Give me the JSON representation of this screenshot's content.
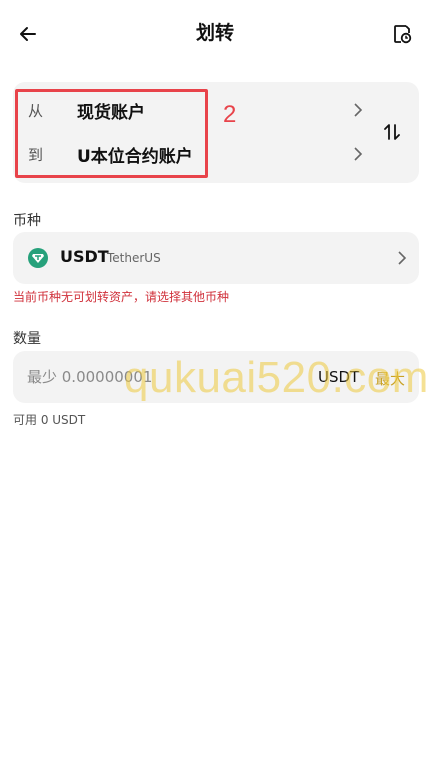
{
  "header": {
    "title": "划转",
    "back_icon": "arrow-left-icon",
    "history_icon": "history-icon"
  },
  "transfer": {
    "from_label": "从",
    "from_account": "现货账户",
    "to_label": "到",
    "to_account": "U本位合约账户",
    "swap_icon": "swap-vertical-icon",
    "annotation_number": "2",
    "annotation_color": "#e8434a"
  },
  "coin": {
    "section_label": "币种",
    "symbol": "USDT",
    "name": "TetherUS",
    "icon": "tether-icon",
    "icon_color": "#26a17b",
    "warning": "当前币种无可划转资产，请选择其他币种",
    "warning_color": "#d0313b"
  },
  "amount": {
    "section_label": "数量",
    "placeholder": "最少 0.00000001",
    "unit": "USDT",
    "max_label": "最大",
    "max_color": "#c9a227",
    "available": "可用 0 USDT"
  },
  "watermark": "qukuai520.com"
}
